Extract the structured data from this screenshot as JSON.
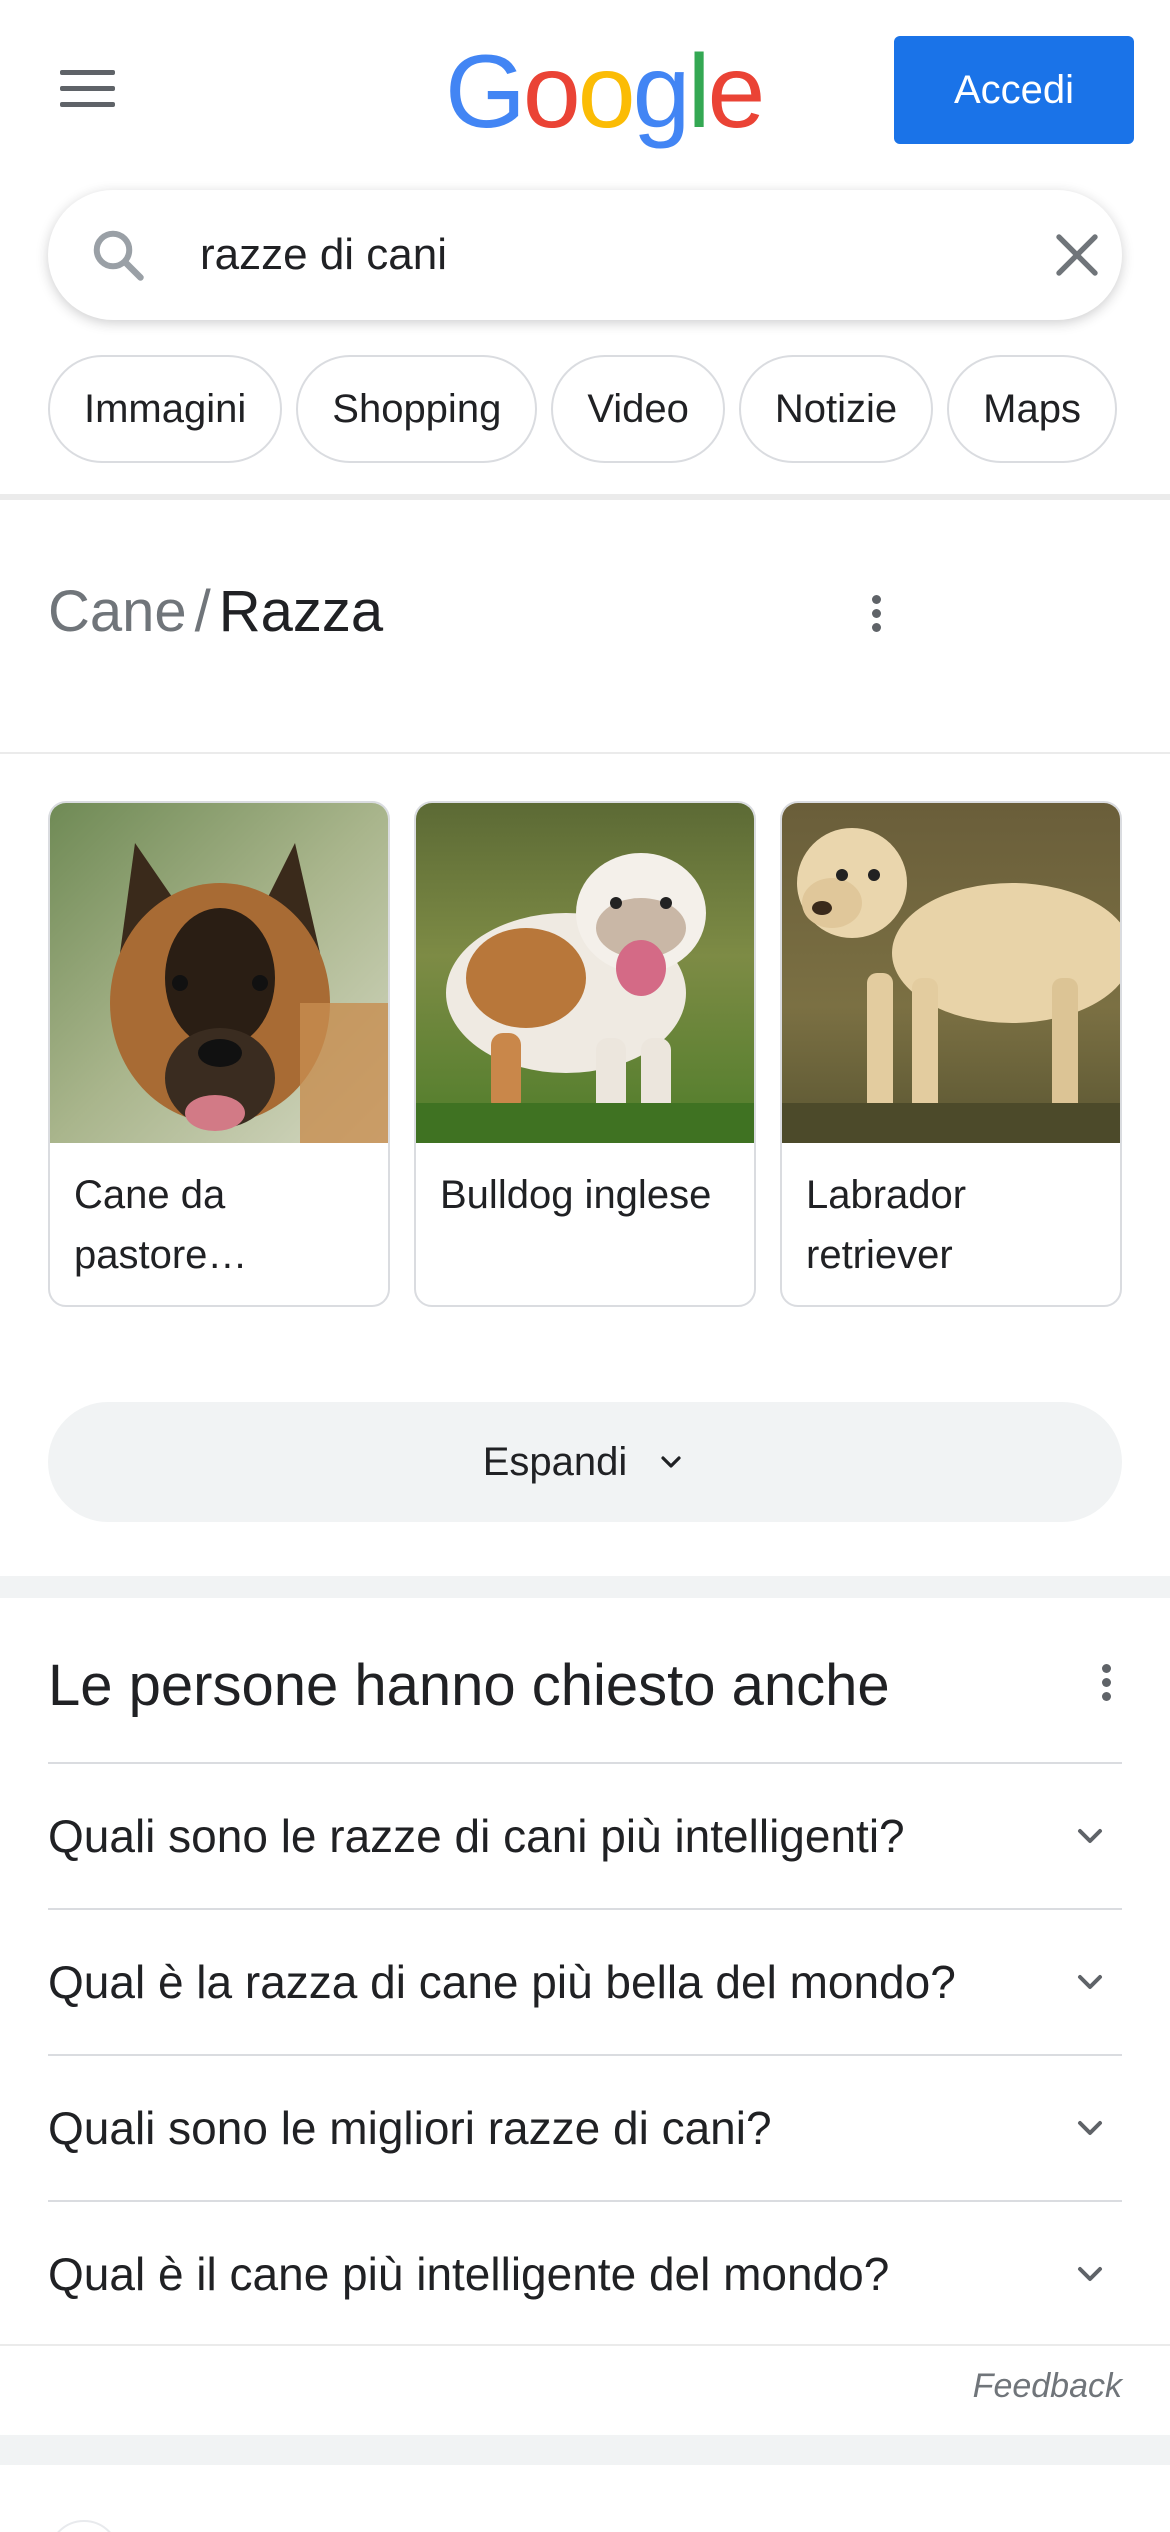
{
  "header": {
    "logo_letters": [
      {
        "ch": "G",
        "color": "#4285F4"
      },
      {
        "ch": "o",
        "color": "#EA4335"
      },
      {
        "ch": "o",
        "color": "#FBBC05"
      },
      {
        "ch": "g",
        "color": "#4285F4"
      },
      {
        "ch": "l",
        "color": "#34A853"
      },
      {
        "ch": "e",
        "color": "#EA4335"
      }
    ],
    "signin_label": "Accedi"
  },
  "search": {
    "value": "razze di cani"
  },
  "chips": [
    "Immagini",
    "Shopping",
    "Video",
    "Notizie",
    "Maps"
  ],
  "breed_header": {
    "parent": "Cane",
    "separator": "/",
    "current": "Razza"
  },
  "breeds": [
    {
      "label": "Cane da pastore…"
    },
    {
      "label": "Bulldog inglese"
    },
    {
      "label": "Labrador retriever"
    }
  ],
  "expand_label": "Espandi",
  "people_also_ask": {
    "title": "Le persone hanno chiesto anche",
    "questions": [
      "Quali sono le razze di cani più intelligenti?",
      "Qual è la razza di cane più bella del mondo?",
      "Quali sono le migliori razze di cani?",
      "Qual è il cane più intelligente del mondo?"
    ]
  },
  "feedback_label": "Feedback",
  "colors": {
    "accent": "#1a73e8",
    "text": "#202124",
    "muted": "#70757a",
    "border": "#dadce0"
  }
}
